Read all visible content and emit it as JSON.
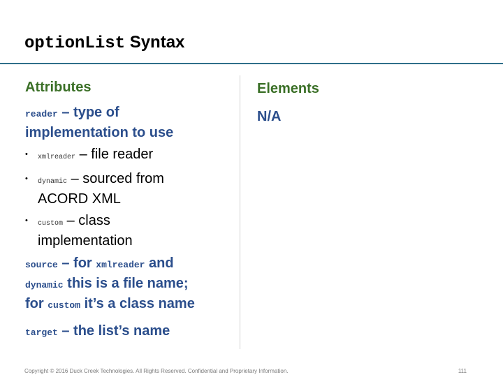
{
  "slide": {
    "title_code": "optionList",
    "title_text": "Syntax"
  },
  "left": {
    "heading": "Attributes",
    "reader": {
      "code": "reader",
      "text_line1": " – type of",
      "text_line2": "implementation to use"
    },
    "bullets": [
      {
        "code": "xmlreader",
        "text": " – file reader"
      },
      {
        "code": "dynamic",
        "text": " – sourced from",
        "text2": "ACORD XML"
      },
      {
        "code": "custom",
        "text": " – class",
        "text2": "implementation"
      }
    ],
    "source": {
      "code1": "source",
      "t1": " – for ",
      "code2": "xmlreader",
      "t2": " and",
      "code3": "dynamic",
      "t3": " this is a file name;",
      "t4": "for ",
      "code4": "custom",
      "t5": " it’s a class name"
    },
    "target": {
      "code": "target",
      "text": " – the list’s name"
    }
  },
  "right": {
    "heading": "Elements",
    "value": "N/A"
  },
  "footer": {
    "copyright": "Copyright © 2016 Duck Creek Technologies. All Rights Reserved. Confidential and Proprietary Information.",
    "page_number": "111"
  }
}
